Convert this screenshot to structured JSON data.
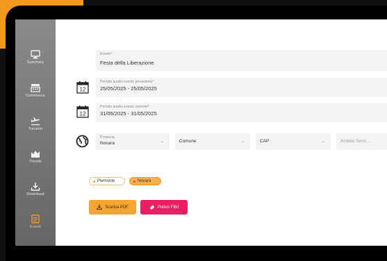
{
  "sidebar": {
    "items": [
      {
        "label": "Summary",
        "icon": "monitor-icon",
        "active": false
      },
      {
        "label": "Commerce",
        "icon": "cash-register-icon",
        "active": false
      },
      {
        "label": "Turismo",
        "icon": "plane-icon",
        "active": false
      },
      {
        "label": "Trends",
        "icon": "bar-chart-icon",
        "active": false
      },
      {
        "label": "Download",
        "icon": "download-icon",
        "active": false
      },
      {
        "label": "Eventi",
        "icon": "calendar-icon",
        "active": true
      }
    ]
  },
  "form": {
    "event": {
      "label": "Evento*",
      "value": "Festa della Liberazione"
    },
    "previous_period": {
      "label": "Periodo analisi evento precedente*",
      "value": "25/05/2025 - 25/05/2025"
    },
    "current_period": {
      "label": "Periodo analisi evento corrente*",
      "value": "31/05/2025 - 31/05/2025"
    },
    "calendar_day": "12",
    "filters": {
      "province": {
        "label": "Provincia",
        "value": "Novara"
      },
      "comune": {
        "value": "Comune"
      },
      "cap": {
        "value": "CAP"
      },
      "ambito": {
        "value": "Ambito Territ..."
      }
    }
  },
  "chips": [
    {
      "label": "Piemonte"
    },
    {
      "label": "Novara"
    }
  ],
  "buttons": {
    "download_pdf": "Scarica PDF",
    "clear_filters": "Pulisci Filtri"
  },
  "colors": {
    "accent": "#f39a1e",
    "danger": "#e91e63",
    "sidebar": "#777777",
    "background": "#111111"
  }
}
